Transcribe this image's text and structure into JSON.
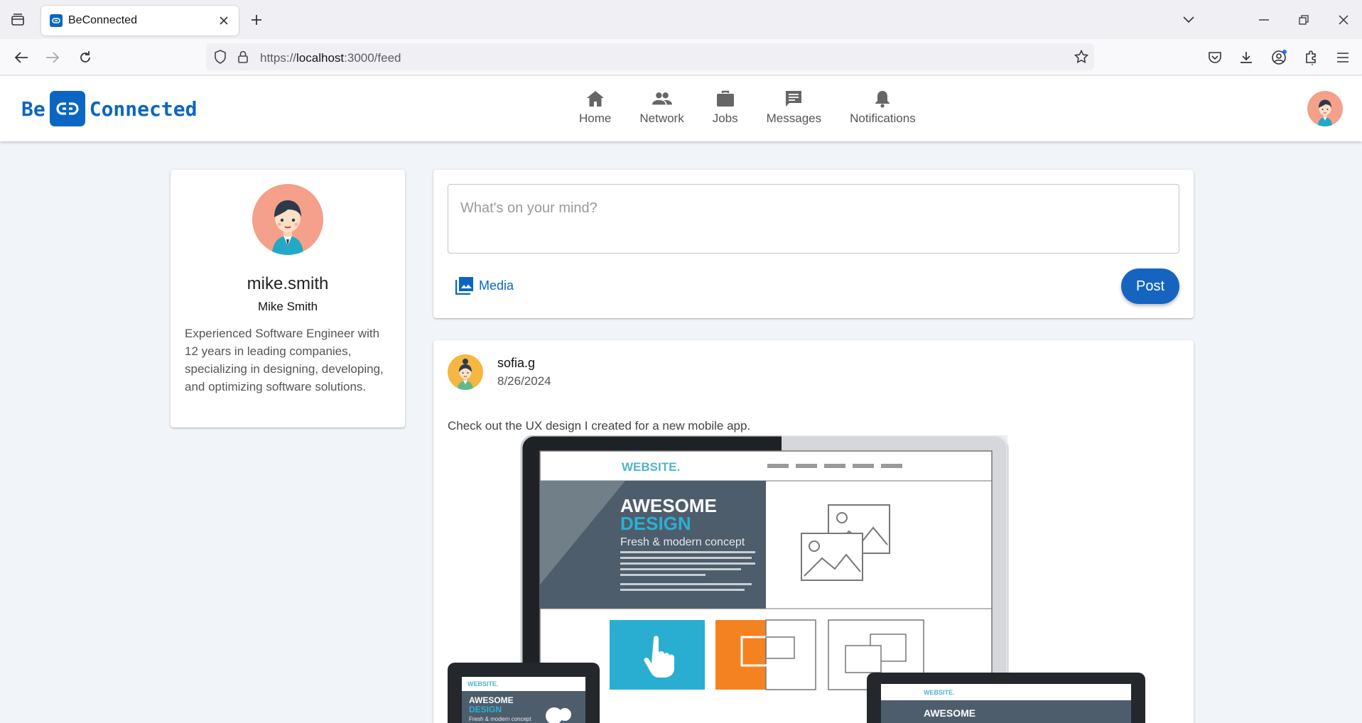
{
  "browser": {
    "tab_title": "BeConnected",
    "url_prefix": "https://",
    "url_host": "localhost",
    "url_path": ":3000/feed"
  },
  "app": {
    "logo_left": "Be",
    "logo_right": "Connected",
    "brand_color": "#0a66c2",
    "nav": [
      {
        "label": "Home",
        "icon": "home-icon"
      },
      {
        "label": "Network",
        "icon": "people-icon"
      },
      {
        "label": "Jobs",
        "icon": "briefcase-icon"
      },
      {
        "label": "Messages",
        "icon": "message-icon"
      },
      {
        "label": "Notifications",
        "icon": "bell-icon"
      }
    ]
  },
  "profile": {
    "username": "mike.smith",
    "full_name": "Mike Smith",
    "bio": "Experienced Software Engineer with 12 years in leading companies, specializing in designing, developing, and optimizing software solutions."
  },
  "composer": {
    "placeholder": "What's on your mind?",
    "media_label": "Media",
    "post_label": "Post"
  },
  "feed": {
    "posts": [
      {
        "username": "sofia.g",
        "date": "8/26/2024",
        "text": "Check out the UX design I created for a new mobile app.",
        "image": {
          "brand": "WEBSITE.",
          "headline_1": "AWESOME",
          "headline_2": "DESIGN",
          "tagline": "Fresh & modern concept"
        }
      }
    ]
  }
}
